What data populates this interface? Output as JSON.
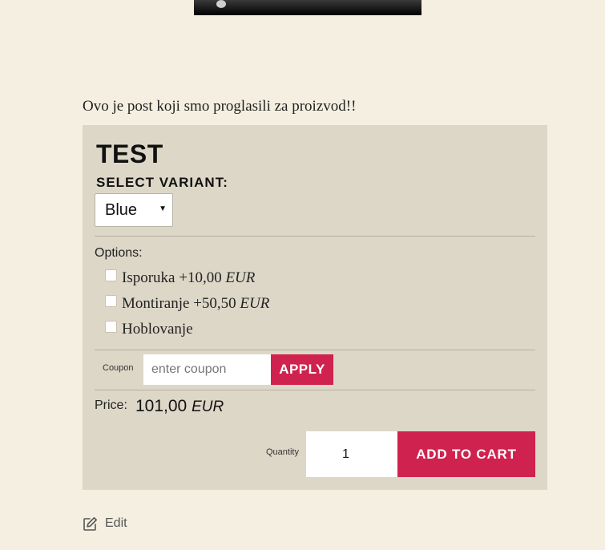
{
  "post": {
    "text": "Ovo je post koji smo proglasili za proizvod!!"
  },
  "product": {
    "title": "TEST",
    "variant_label": "SELECT VARIANT:",
    "variant_selected": "Blue",
    "options_label": "Options:",
    "options": [
      {
        "name": "Isporuka",
        "price": "+10,00",
        "currency": "EUR"
      },
      {
        "name": "Montiranje",
        "price": "+50,50",
        "currency": "EUR"
      },
      {
        "name": "Hoblovanje"
      }
    ],
    "coupon": {
      "label": "Coupon",
      "placeholder": "enter coupon",
      "button": "APPLY"
    },
    "price": {
      "label": "Price:",
      "value": "101,00",
      "currency": "EUR"
    },
    "quantity": {
      "label": "Quantity",
      "value": "1"
    },
    "cart_button": "ADD TO CART"
  },
  "edit": {
    "label": "Edit",
    "icon": "edit-icon"
  },
  "colors": {
    "background": "#f4efe0",
    "card": "#ddd7c8",
    "accent": "#cf224e"
  }
}
